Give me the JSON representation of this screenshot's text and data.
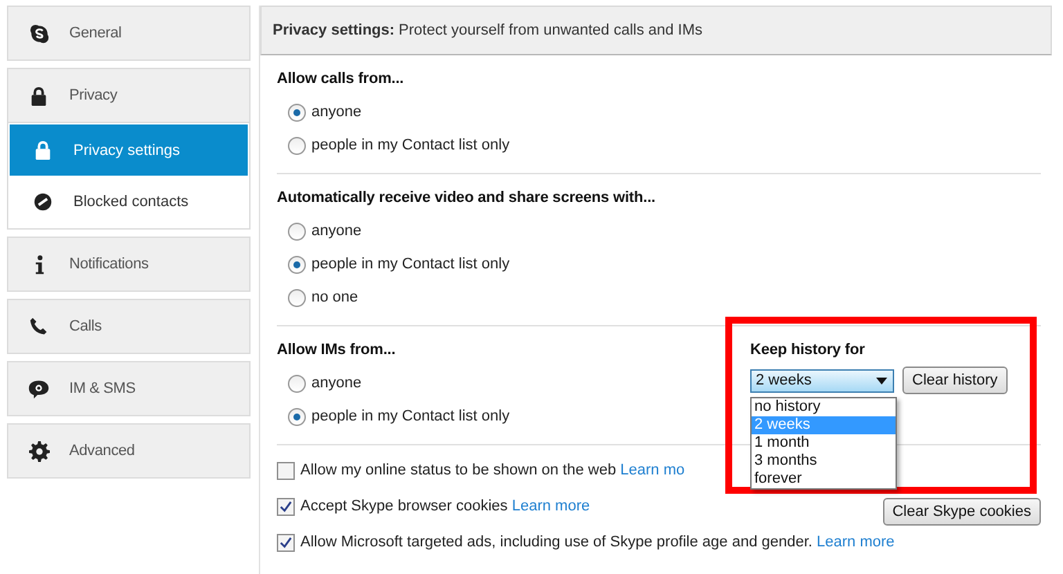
{
  "sidebar": {
    "items": [
      {
        "label": "General",
        "selected": false
      },
      {
        "label": "Privacy",
        "selected": false,
        "expanded": true,
        "children": [
          {
            "label": "Privacy settings",
            "selected": true
          },
          {
            "label": "Blocked contacts",
            "selected": false
          }
        ]
      },
      {
        "label": "Notifications",
        "selected": false
      },
      {
        "label": "Calls",
        "selected": false
      },
      {
        "label": "IM & SMS",
        "selected": false
      },
      {
        "label": "Advanced",
        "selected": false
      }
    ]
  },
  "header": {
    "title": "Privacy settings:",
    "subtitle": "Protect yourself from unwanted calls and IMs"
  },
  "radio_groups": [
    {
      "title": "Allow calls from...",
      "options": [
        {
          "label": "anyone",
          "selected": true
        },
        {
          "label": "people in my Contact list only",
          "selected": false
        }
      ]
    },
    {
      "title": "Automatically receive video and share screens with...",
      "options": [
        {
          "label": "anyone",
          "selected": false
        },
        {
          "label": "people in my Contact list only",
          "selected": true
        },
        {
          "label": "no one",
          "selected": false
        }
      ]
    },
    {
      "title": "Allow IMs from...",
      "options": [
        {
          "label": "anyone",
          "selected": false
        },
        {
          "label": "people in my Contact list only",
          "selected": true
        }
      ]
    }
  ],
  "keep_history": {
    "title": "Keep history for",
    "dropdown": {
      "value": "2 weeks",
      "expanded": true,
      "options": [
        {
          "label": "no history",
          "selected": false
        },
        {
          "label": "2 weeks",
          "selected": true
        },
        {
          "label": "1 month",
          "selected": false
        },
        {
          "label": "3 months",
          "selected": false
        },
        {
          "label": "forever",
          "selected": false
        }
      ]
    },
    "button": "Clear history"
  },
  "checkboxes": [
    {
      "label": "Allow my online status to be shown on the web",
      "checked": false,
      "link": "Learn mo"
    },
    {
      "label": "Accept Skype browser cookies",
      "checked": true,
      "link": "Learn more",
      "button": "Clear Skype cookies"
    },
    {
      "label": "Allow Microsoft targeted ads, including use of Skype profile age and gender.",
      "checked": true,
      "link": "Learn more"
    }
  ]
}
